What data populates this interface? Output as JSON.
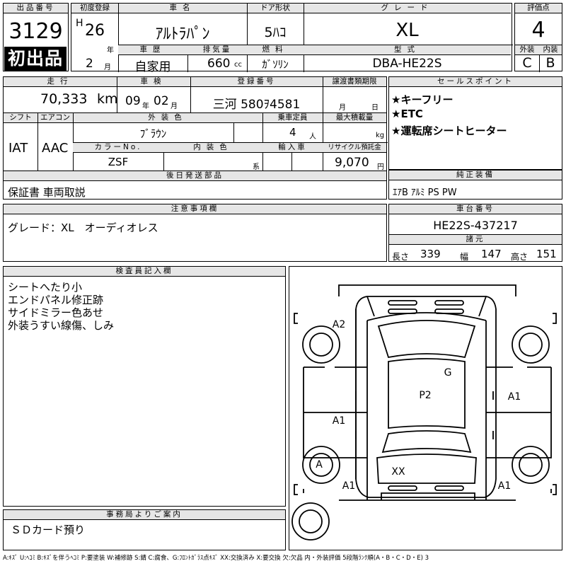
{
  "lot": {
    "label": "出品番号",
    "number": "3129",
    "first_listing": "初出品"
  },
  "first_reg": {
    "label": "初度登録",
    "era": "H",
    "year": "26",
    "year_unit": "年",
    "month": "2",
    "month_unit": "月"
  },
  "car_name": {
    "label": "車名",
    "value": "ｱﾙﾄﾗﾊﾟﾝ"
  },
  "door": {
    "label": "ドア形状",
    "value": "5ﾊｺ"
  },
  "grade": {
    "label": "グレード",
    "value": "XL"
  },
  "score": {
    "label": "評価点",
    "value": "4"
  },
  "history": {
    "label": "車歴",
    "value": "自家用"
  },
  "displacement": {
    "label": "排気量",
    "value": "660",
    "unit": "cc"
  },
  "fuel": {
    "label": "燃料",
    "value": "ｶﾞｿﾘﾝ"
  },
  "model": {
    "label": "型式",
    "value": "DBA-HE22S"
  },
  "exterior_score": {
    "label": "外装",
    "value": "C"
  },
  "interior_score": {
    "label": "内装",
    "value": "B"
  },
  "mileage": {
    "label": "走行",
    "value": "70,333",
    "unit": "km"
  },
  "inspection": {
    "label": "車検",
    "year": "09",
    "year_unit": "年",
    "month": "02",
    "month_unit": "月"
  },
  "registration": {
    "label": "登録番号",
    "value": "三河 580ｦ4581"
  },
  "transfer": {
    "label": "譲渡書類期限",
    "month_unit": "月",
    "day_unit": "日"
  },
  "sales_points": {
    "label": "セールスポイント",
    "items": [
      "★キーフリー",
      "★ETC",
      "★運転席シートヒーター"
    ]
  },
  "shift": {
    "label": "シフト",
    "value": "IAT"
  },
  "aircon": {
    "label": "エアコン",
    "value": "AAC"
  },
  "ext_color": {
    "label": "外装色",
    "value": "ﾌﾞﾗｳﾝ"
  },
  "capacity": {
    "label": "乗車定員",
    "value": "4",
    "unit": "人"
  },
  "max_load": {
    "label": "最大積載量",
    "unit": "kg"
  },
  "color_no": {
    "label": "カラーNo.",
    "value": "ZSF"
  },
  "int_color": {
    "label": "内装色",
    "suffix": "系"
  },
  "import": {
    "label": "輸入車"
  },
  "recycle": {
    "label": "リサイクル預託金",
    "value": "9,070",
    "unit": "円"
  },
  "later_parts": {
    "label": "後日発送部品",
    "value": "保証書 車両取説"
  },
  "equipment": {
    "label": "純正装備",
    "value": "ｴｱB ｱﾙﾐ PS PW"
  },
  "notes": {
    "label": "注意事項欄",
    "value": "グレード：XL　オーディオレス"
  },
  "chassis": {
    "label": "車台番号",
    "value": "HE22S-437217"
  },
  "specs": {
    "label": "諸元",
    "length_label": "長さ",
    "length": "339",
    "width_label": "幅",
    "width": "147",
    "height_label": "高さ",
    "height": "151"
  },
  "inspector": {
    "label": "検査員記入欄",
    "lines": [
      "シートへたり小",
      "エンドパネル修正跡",
      "サイドミラー色あせ",
      "外装うすい線傷、しみ"
    ]
  },
  "office": {
    "label": "事務局よりご案内",
    "value": "ＳＤカード預り"
  },
  "diagram": {
    "marks": [
      "A2",
      "G",
      "P2",
      "A1",
      "A1",
      "A",
      "XX",
      "A1",
      "A1"
    ]
  },
  "legend": "A:ｷｽﾞ U:ﾍｺﾐ B:ｷｽﾞを伴うﾍｺﾐ P:要塗装 W:補修跡 S:錆 C:腐食、G:ﾌﾛﾝﾄｶﾞﾗｽ点ｷｽﾞ XX:交換済み X:要交換 欠:欠品 内・外装評価 5段階ﾗﾝｸ順(A・B・C・D・E) 3"
}
